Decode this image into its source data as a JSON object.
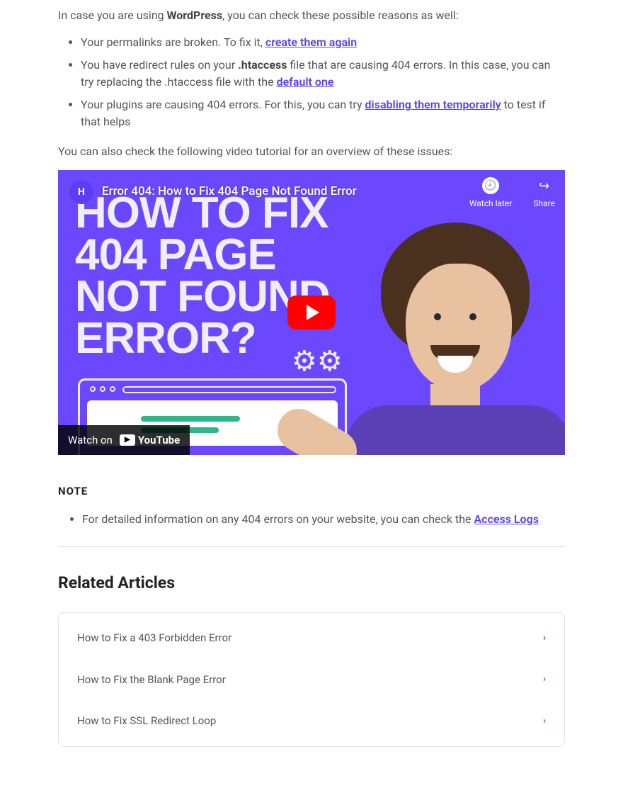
{
  "intro": {
    "prefix": "In case you are using ",
    "bold": "WordPress",
    "suffix": ", you can check these possible reasons as well:"
  },
  "bullets": [
    {
      "pre": "Your permalinks are broken. To fix it, ",
      "link": "create them again",
      "post": ""
    },
    {
      "pre": "You have redirect rules on your ",
      "bold": ".htaccess",
      "mid": " file that are causing 404 errors. In this case, you can try replacing the .htaccess file with the ",
      "link": "default one",
      "post": ""
    },
    {
      "pre": "Your plugins are causing 404 errors. For this, you can try ",
      "link": "disabling them temporarily",
      "post": " to test if that helps"
    }
  ],
  "check_video": "You can also check the following video tutorial for an overview of these issues:",
  "video": {
    "channel_letter": "H",
    "title": "Error 404: How to Fix 404 Page Not Found Error",
    "watch_later": "Watch later",
    "share": "Share",
    "headline_l1": "HOW TO FIX",
    "headline_l2": "404 PAGE",
    "headline_l3": "NOT FOUND",
    "headline_l4": "ERROR?",
    "watch_on": "Watch on",
    "youtube": "YouTube"
  },
  "note": {
    "heading": "NOTE",
    "bullet_pre": "For detailed information on any 404 errors on your website, you can check the ",
    "bullet_link": "Access Logs"
  },
  "related": {
    "heading": "Related Articles",
    "items": [
      "How to Fix a 403 Forbidden Error",
      "How to Fix the Blank Page Error",
      "How to Fix SSL Redirect Loop"
    ]
  }
}
